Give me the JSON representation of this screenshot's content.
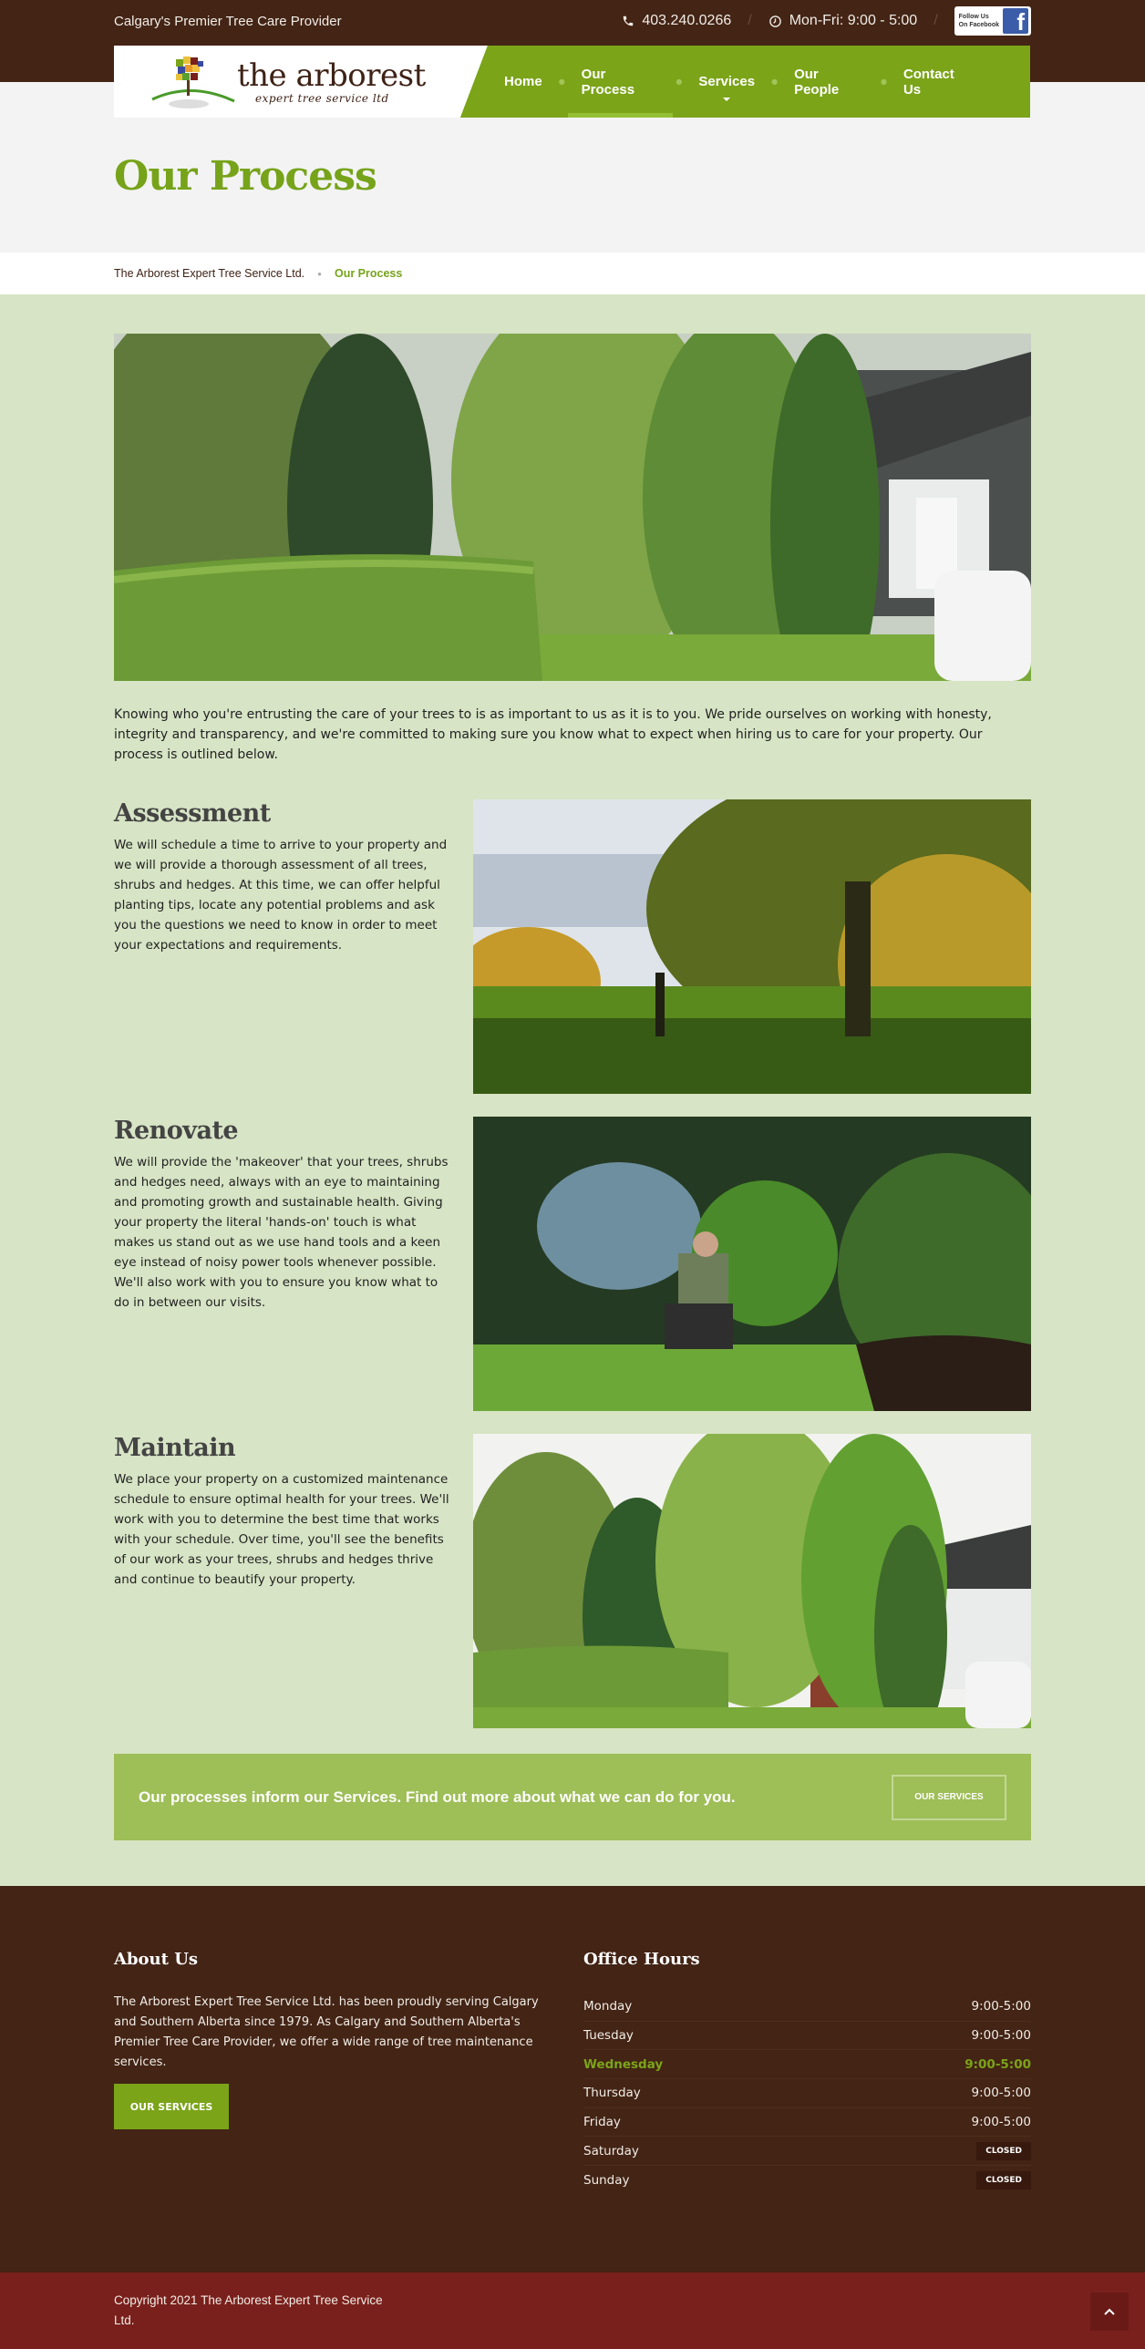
{
  "topbar": {
    "tagline": "Calgary's Premier Tree Care Provider",
    "phone": "403.240.0266",
    "phone_icon": "phone-icon",
    "hours": "Mon-Fri: 9:00 - 5:00",
    "hours_icon": "clock-icon",
    "facebook": {
      "line1": "Follow Us",
      "line2": "On Facebook",
      "glyph": "f"
    }
  },
  "logo": {
    "main": "the arborest",
    "sub": "expert tree service ltd"
  },
  "nav": {
    "items": [
      {
        "label": "Home",
        "active": false
      },
      {
        "label": "Our Process",
        "active": true
      },
      {
        "label": "Services",
        "active": false,
        "has_dropdown": true
      },
      {
        "label": "Our People",
        "active": false
      },
      {
        "label": "Contact Us",
        "active": false
      }
    ]
  },
  "page_title": "Our Process",
  "breadcrumb": {
    "home": "The Arborest Expert Tree Service Ltd.",
    "current": "Our Process"
  },
  "intro": "Knowing who you're entrusting the care of your trees to is as important to us as it is to you. We pride ourselves on working with honesty, integrity and transparency, and we're committed to making sure you know what to expect when hiring us to care for your property. Our process is outlined below.",
  "sections": [
    {
      "title": "Assessment",
      "body": "We will schedule a time to arrive to your property and we will provide a thorough assessment of all trees, shrubs and hedges. At this time, we can offer helpful planting tips, locate any potential problems and ask you the questions we need to know in order to meet your expectations and requirements."
    },
    {
      "title": "Renovate",
      "body": "We will provide the 'makeover' that your trees, shrubs and hedges need, always with an eye to maintaining and promoting growth and sustainable health. Giving your property the literal 'hands-on' touch is what makes us stand out as we use hand tools and a keen eye instead of noisy power tools whenever possible. We'll also work with you to ensure you know what to do in between our visits."
    },
    {
      "title": "Maintain",
      "body": "We place your property on a customized maintenance schedule to ensure optimal health for your trees. We'll work with you to determine the best time that works with your schedule. Over time, you'll see the benefits of our work as your trees, shrubs and hedges thrive and continue to beautify your property."
    }
  ],
  "cta": {
    "text": "Our processes inform our Services. Find out more about what we can do for you.",
    "button": "OUR SERVICES"
  },
  "footer": {
    "about": {
      "title": "About Us",
      "text": "The Arborest Expert Tree Service Ltd. has been proudly serving Calgary and Southern Alberta since 1979. As Calgary and Southern Alberta's Premier Tree Care Provider, we offer a wide range of tree maintenance services.",
      "button": "OUR SERVICES"
    },
    "hours": {
      "title": "Office Hours",
      "rows": [
        {
          "day": "Monday",
          "time": "9:00-5:00",
          "closed": false,
          "today": false
        },
        {
          "day": "Tuesday",
          "time": "9:00-5:00",
          "closed": false,
          "today": false
        },
        {
          "day": "Wednesday",
          "time": "9:00-5:00",
          "closed": false,
          "today": true
        },
        {
          "day": "Thursday",
          "time": "9:00-5:00",
          "closed": false,
          "today": false
        },
        {
          "day": "Friday",
          "time": "9:00-5:00",
          "closed": false,
          "today": false
        },
        {
          "day": "Saturday",
          "time": "CLOSED",
          "closed": true,
          "today": false
        },
        {
          "day": "Sunday",
          "time": "CLOSED",
          "closed": true,
          "today": false
        }
      ]
    }
  },
  "copyright": "Copyright 2021 The Arborest Expert Tree Service Ltd.",
  "back_to_top": "^",
  "colors": {
    "brown": "#432415",
    "green": "#7ba419",
    "light_green_bg": "#d7e4c5",
    "cta_green": "#9ebe57",
    "copyright_red": "#7a201c"
  }
}
